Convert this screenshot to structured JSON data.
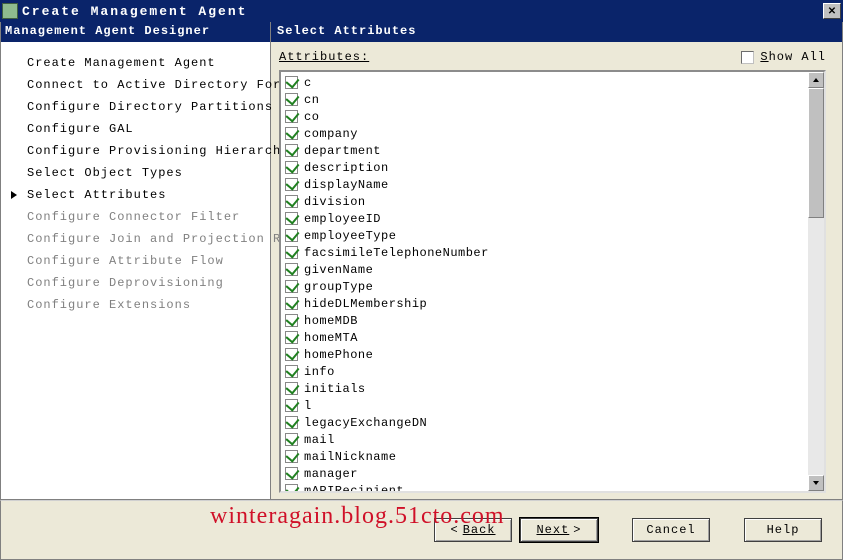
{
  "window": {
    "title": "Create Management Agent",
    "close_symbol": "✕"
  },
  "sidebar": {
    "header": "Management Agent Designer",
    "items": [
      {
        "label": "Create Management Agent",
        "state": "enabled"
      },
      {
        "label": "Connect to Active Directory Forest",
        "state": "enabled"
      },
      {
        "label": "Configure Directory Partitions",
        "state": "enabled"
      },
      {
        "label": "Configure GAL",
        "state": "enabled"
      },
      {
        "label": "Configure Provisioning Hierarchy",
        "state": "enabled"
      },
      {
        "label": "Select Object Types",
        "state": "enabled"
      },
      {
        "label": "Select Attributes",
        "state": "current"
      },
      {
        "label": "Configure Connector Filter",
        "state": "disabled"
      },
      {
        "label": "Configure Join and Projection Rules",
        "state": "disabled"
      },
      {
        "label": "Configure Attribute Flow",
        "state": "disabled"
      },
      {
        "label": "Configure Deprovisioning",
        "state": "disabled"
      },
      {
        "label": "Configure Extensions",
        "state": "disabled"
      }
    ]
  },
  "main": {
    "header": "Select Attributes",
    "attrs_label": "Attributes:",
    "show_all_label_pre": "S",
    "show_all_label_post": "how All",
    "show_all_checked": false,
    "attributes": [
      {
        "name": "c",
        "checked": true
      },
      {
        "name": "cn",
        "checked": true
      },
      {
        "name": "co",
        "checked": true
      },
      {
        "name": "company",
        "checked": true
      },
      {
        "name": "department",
        "checked": true
      },
      {
        "name": "description",
        "checked": true
      },
      {
        "name": "displayName",
        "checked": true
      },
      {
        "name": "division",
        "checked": true
      },
      {
        "name": "employeeID",
        "checked": true
      },
      {
        "name": "employeeType",
        "checked": true
      },
      {
        "name": "facsimileTelephoneNumber",
        "checked": true
      },
      {
        "name": "givenName",
        "checked": true
      },
      {
        "name": "groupType",
        "checked": true
      },
      {
        "name": "hideDLMembership",
        "checked": true
      },
      {
        "name": "homeMDB",
        "checked": true
      },
      {
        "name": "homeMTA",
        "checked": true
      },
      {
        "name": "homePhone",
        "checked": true
      },
      {
        "name": "info",
        "checked": true
      },
      {
        "name": "initials",
        "checked": true
      },
      {
        "name": "l",
        "checked": true
      },
      {
        "name": "legacyExchangeDN",
        "checked": true
      },
      {
        "name": "mail",
        "checked": true
      },
      {
        "name": "mailNickname",
        "checked": true
      },
      {
        "name": "manager",
        "checked": true
      },
      {
        "name": "mAPIRecipient",
        "checked": true
      }
    ]
  },
  "footer": {
    "back": "Back",
    "next": "Next",
    "cancel": "Cancel",
    "help": "Help"
  },
  "watermark": "winteragain.blog.51cto.com"
}
